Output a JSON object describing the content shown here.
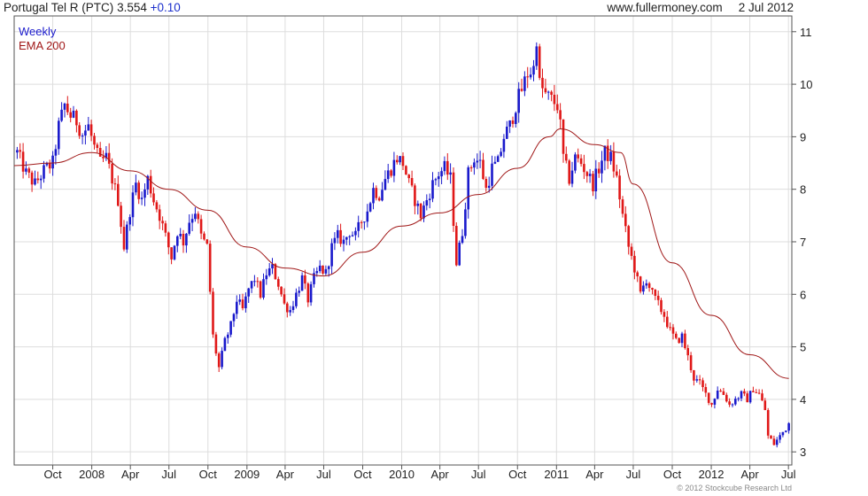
{
  "header": {
    "name": "Portugal Tel R (PTC)",
    "price": "3.554",
    "change": "+0.10",
    "website": "www.fullermoney.com",
    "date": "2 Jul 2012"
  },
  "footer": {
    "copyright": "© 2012 Stockcube Research Ltd"
  },
  "colors": {
    "up": "#1a1acc",
    "down": "#e01818",
    "ema": "#a01818",
    "grid": "#dddddd",
    "axis": "#555555"
  },
  "chart_data": {
    "type": "candlestick",
    "legend": [
      {
        "label": "Weekly",
        "color": "#1a1acc"
      },
      {
        "label": "EMA 200",
        "color": "#a01818"
      }
    ],
    "ylim": [
      2.75,
      11.3
    ],
    "yticks": [
      3,
      4,
      5,
      6,
      7,
      8,
      9,
      10,
      11
    ],
    "x_start": "2007-07-02",
    "x_end": "2012-07-09",
    "xticks": [
      {
        "label": "Oct",
        "date": "2007-10-01"
      },
      {
        "label": "2008",
        "date": "2008-01-01"
      },
      {
        "label": "Apr",
        "date": "2008-04-01"
      },
      {
        "label": "Jul",
        "date": "2008-07-01"
      },
      {
        "label": "Oct",
        "date": "2008-10-01"
      },
      {
        "label": "2009",
        "date": "2009-01-01"
      },
      {
        "label": "Apr",
        "date": "2009-04-01"
      },
      {
        "label": "Jul",
        "date": "2009-07-01"
      },
      {
        "label": "Oct",
        "date": "2009-10-01"
      },
      {
        "label": "2010",
        "date": "2010-01-01"
      },
      {
        "label": "Apr",
        "date": "2010-04-01"
      },
      {
        "label": "Jul",
        "date": "2010-07-01"
      },
      {
        "label": "Oct",
        "date": "2010-10-01"
      },
      {
        "label": "2011",
        "date": "2011-01-01"
      },
      {
        "label": "Apr",
        "date": "2011-04-01"
      },
      {
        "label": "Jul",
        "date": "2011-07-01"
      },
      {
        "label": "Oct",
        "date": "2011-10-01"
      },
      {
        "label": "2012",
        "date": "2012-01-01"
      },
      {
        "label": "Apr",
        "date": "2012-04-01"
      },
      {
        "label": "Jul",
        "date": "2012-07-01"
      }
    ],
    "price_path": [
      [
        "2007-07-09",
        8.7
      ],
      [
        "2007-07-30",
        8.3
      ],
      [
        "2007-08-20",
        8.1
      ],
      [
        "2007-09-10",
        8.35
      ],
      [
        "2007-10-01",
        8.5
      ],
      [
        "2007-10-15",
        9.2
      ],
      [
        "2007-10-29",
        9.6
      ],
      [
        "2007-11-12",
        9.4
      ],
      [
        "2007-11-26",
        9.3
      ],
      [
        "2007-12-10",
        9.05
      ],
      [
        "2007-12-24",
        9.2
      ],
      [
        "2008-01-07",
        8.8
      ],
      [
        "2008-01-21",
        8.5
      ],
      [
        "2008-02-04",
        8.6
      ],
      [
        "2008-02-18",
        8.2
      ],
      [
        "2008-03-03",
        7.8
      ],
      [
        "2008-03-17",
        6.9
      ],
      [
        "2008-03-31",
        7.6
      ],
      [
        "2008-04-14",
        8.1
      ],
      [
        "2008-04-28",
        7.8
      ],
      [
        "2008-05-12",
        8.2
      ],
      [
        "2008-05-26",
        7.8
      ],
      [
        "2008-06-09",
        7.5
      ],
      [
        "2008-06-23",
        7.1
      ],
      [
        "2008-07-07",
        6.7
      ],
      [
        "2008-07-21",
        7.2
      ],
      [
        "2008-08-04",
        7.0
      ],
      [
        "2008-08-18",
        7.4
      ],
      [
        "2008-09-01",
        7.6
      ],
      [
        "2008-09-15",
        7.1
      ],
      [
        "2008-09-29",
        6.9
      ],
      [
        "2008-10-13",
        5.2
      ],
      [
        "2008-10-27",
        4.6
      ],
      [
        "2008-11-10",
        5.1
      ],
      [
        "2008-11-24",
        5.4
      ],
      [
        "2008-12-08",
        5.9
      ],
      [
        "2008-12-22",
        5.7
      ],
      [
        "2009-01-05",
        6.1
      ],
      [
        "2009-01-19",
        6.3
      ],
      [
        "2009-02-02",
        6.0
      ],
      [
        "2009-02-16",
        6.4
      ],
      [
        "2009-03-02",
        6.5
      ],
      [
        "2009-03-16",
        6.2
      ],
      [
        "2009-03-30",
        5.8
      ],
      [
        "2009-04-13",
        5.7
      ],
      [
        "2009-04-27",
        6.0
      ],
      [
        "2009-05-11",
        6.3
      ],
      [
        "2009-05-25",
        5.9
      ],
      [
        "2009-06-08",
        6.3
      ],
      [
        "2009-06-22",
        6.5
      ],
      [
        "2009-07-06",
        6.4
      ],
      [
        "2009-07-20",
        6.9
      ],
      [
        "2009-08-03",
        7.1
      ],
      [
        "2009-08-17",
        7.0
      ],
      [
        "2009-08-31",
        7.2
      ],
      [
        "2009-09-14",
        7.1
      ],
      [
        "2009-09-28",
        7.4
      ],
      [
        "2009-10-12",
        7.6
      ],
      [
        "2009-10-26",
        8.0
      ],
      [
        "2009-11-09",
        7.9
      ],
      [
        "2009-11-23",
        8.2
      ],
      [
        "2009-12-07",
        8.4
      ],
      [
        "2009-12-21",
        8.6
      ],
      [
        "2010-01-04",
        8.5
      ],
      [
        "2010-01-18",
        8.1
      ],
      [
        "2010-02-01",
        7.8
      ],
      [
        "2010-02-15",
        7.5
      ],
      [
        "2010-03-01",
        7.8
      ],
      [
        "2010-03-15",
        8.1
      ],
      [
        "2010-03-29",
        8.3
      ],
      [
        "2010-04-12",
        8.4
      ],
      [
        "2010-04-26",
        8.2
      ],
      [
        "2010-05-03",
        7.4
      ],
      [
        "2010-05-10",
        6.6
      ],
      [
        "2010-05-24",
        7.2
      ],
      [
        "2010-06-07",
        8.3
      ],
      [
        "2010-06-21",
        8.6
      ],
      [
        "2010-07-05",
        8.5
      ],
      [
        "2010-07-19",
        8.0
      ],
      [
        "2010-08-02",
        8.4
      ],
      [
        "2010-08-16",
        8.5
      ],
      [
        "2010-08-30",
        9.0
      ],
      [
        "2010-09-13",
        9.2
      ],
      [
        "2010-09-27",
        9.6
      ],
      [
        "2010-10-11",
        9.9
      ],
      [
        "2010-10-25",
        10.2
      ],
      [
        "2010-11-08",
        10.3
      ],
      [
        "2010-11-15",
        10.9
      ],
      [
        "2010-11-22",
        10.0
      ],
      [
        "2010-12-06",
        9.8
      ],
      [
        "2010-12-20",
        9.7
      ],
      [
        "2011-01-03",
        9.6
      ],
      [
        "2011-01-10",
        9.2
      ],
      [
        "2011-01-17",
        8.6
      ],
      [
        "2011-01-31",
        8.2
      ],
      [
        "2011-02-14",
        8.6
      ],
      [
        "2011-02-28",
        8.5
      ],
      [
        "2011-03-14",
        8.3
      ],
      [
        "2011-03-28",
        8.1
      ],
      [
        "2011-04-11",
        8.4
      ],
      [
        "2011-04-25",
        8.7
      ],
      [
        "2011-05-09",
        8.6
      ],
      [
        "2011-05-23",
        8.2
      ],
      [
        "2011-06-06",
        7.5
      ],
      [
        "2011-06-20",
        6.9
      ],
      [
        "2011-07-04",
        6.5
      ],
      [
        "2011-07-18",
        6.0
      ],
      [
        "2011-08-01",
        6.3
      ],
      [
        "2011-08-15",
        6.0
      ],
      [
        "2011-08-29",
        5.8
      ],
      [
        "2011-09-12",
        5.6
      ],
      [
        "2011-09-26",
        5.3
      ],
      [
        "2011-10-10",
        5.1
      ],
      [
        "2011-10-24",
        5.2
      ],
      [
        "2011-11-07",
        4.8
      ],
      [
        "2011-11-21",
        4.4
      ],
      [
        "2011-12-05",
        4.3
      ],
      [
        "2011-12-19",
        4.1
      ],
      [
        "2012-01-02",
        3.9
      ],
      [
        "2012-01-16",
        4.2
      ],
      [
        "2012-01-30",
        4.1
      ],
      [
        "2012-02-13",
        3.9
      ],
      [
        "2012-02-27",
        4.0
      ],
      [
        "2012-03-12",
        4.1
      ],
      [
        "2012-03-26",
        4.0
      ],
      [
        "2012-04-09",
        4.2
      ],
      [
        "2012-04-23",
        4.1
      ],
      [
        "2012-05-07",
        3.8
      ],
      [
        "2012-05-14",
        3.3
      ],
      [
        "2012-05-28",
        3.15
      ],
      [
        "2012-06-11",
        3.3
      ],
      [
        "2012-06-25",
        3.45
      ],
      [
        "2012-07-02",
        3.55
      ]
    ],
    "ema_path": [
      [
        "2007-07-02",
        8.45
      ],
      [
        "2007-10-01",
        8.5
      ],
      [
        "2008-01-01",
        8.7
      ],
      [
        "2008-04-01",
        8.35
      ],
      [
        "2008-07-01",
        8.0
      ],
      [
        "2008-10-01",
        7.6
      ],
      [
        "2009-01-01",
        6.9
      ],
      [
        "2009-04-01",
        6.5
      ],
      [
        "2009-07-01",
        6.35
      ],
      [
        "2009-10-01",
        6.8
      ],
      [
        "2010-01-01",
        7.3
      ],
      [
        "2010-04-01",
        7.55
      ],
      [
        "2010-07-01",
        7.9
      ],
      [
        "2010-10-01",
        8.4
      ],
      [
        "2010-12-15",
        9.0
      ],
      [
        "2011-01-10",
        9.15
      ],
      [
        "2011-04-01",
        8.85
      ],
      [
        "2011-06-01",
        8.7
      ],
      [
        "2011-07-01",
        8.1
      ],
      [
        "2011-10-01",
        6.6
      ],
      [
        "2012-01-01",
        5.6
      ],
      [
        "2012-04-01",
        4.85
      ],
      [
        "2012-07-02",
        4.4
      ]
    ]
  }
}
